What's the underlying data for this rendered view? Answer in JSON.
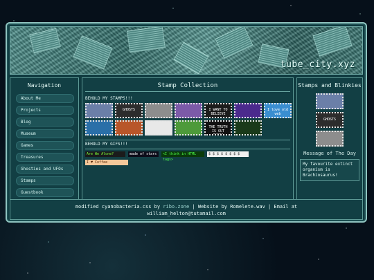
{
  "site": {
    "title": "tube_city.xyz"
  },
  "nav": {
    "title": "Navigation",
    "items": [
      {
        "label": "About Me"
      },
      {
        "label": "Projects"
      },
      {
        "label": "Blog"
      },
      {
        "label": "Museum"
      },
      {
        "label": "Games"
      },
      {
        "label": "Treasures"
      },
      {
        "label": "Ghosties and UFOs"
      },
      {
        "label": "Stamps"
      },
      {
        "label": "Guestbook"
      }
    ]
  },
  "main": {
    "title": "Stamp Collection",
    "stamps_heading": "BEHOLD MY STAMPS!!!",
    "stamps": [
      {
        "caption": "",
        "color": "#6b7fa8",
        "icon": "computer-icon"
      },
      {
        "caption": "GHOSTS",
        "color": "#2c2c2c",
        "icon": "ghost-icon"
      },
      {
        "caption": "",
        "color": "#8d8d8d",
        "icon": "ufo-icon"
      },
      {
        "caption": "",
        "color": "#7c5aa8",
        "icon": "spiral-icon"
      },
      {
        "caption": "I WANT TO BELIEVE",
        "color": "#1b1b1b",
        "icon": "ufo-icon"
      },
      {
        "caption": "",
        "color": "#4b2a8d",
        "icon": "retro-web-icon"
      },
      {
        "caption": "I love old web",
        "color": "#3a8ed0",
        "icon": "heart-icon"
      },
      {
        "caption": "",
        "color": "#2a6fa8",
        "icon": "water-icon"
      },
      {
        "caption": "",
        "color": "#b8562a",
        "icon": "animal-icon"
      },
      {
        "caption": "",
        "color": "#e8e8e8",
        "icon": "neocities-icon"
      },
      {
        "caption": "",
        "color": "#4d9a3a",
        "icon": "minecraft-icon"
      },
      {
        "caption": "THE TRUTH IS OUT THERE",
        "color": "#111111",
        "icon": "truth-icon"
      },
      {
        "caption": "",
        "color": "#1a3a1a",
        "icon": "alien-icon"
      }
    ],
    "gifs_heading": "BEHOLD MY GIFS!!!",
    "gifs": [
      {
        "text": "Are We Alone?",
        "bg": "#1b1b1b",
        "fg": "#7cff3a",
        "icon": "alien-gif-icon"
      },
      {
        "text": "made of stars",
        "bg": "#0d0d1a",
        "fg": "#ffffff",
        "icon": "stars-gif-icon"
      },
      {
        "text": "<I think in HTML tags>",
        "bg": "#0a3a0a",
        "fg": "#4dff4d",
        "icon": "html-gif-icon"
      },
      {
        "text": "$ $ $ $ $ $ $ $",
        "bg": "#f0f0f0",
        "fg": "#222222",
        "icon": "money-gif-icon"
      },
      {
        "text": "I ♥ Coffee",
        "bg": "#f4c89a",
        "fg": "#5a2a0a",
        "icon": "coffee-gif-icon"
      }
    ]
  },
  "side": {
    "title": "Stamps and Blinkies",
    "stamps": [
      {
        "caption": "",
        "color": "#6b7fa8"
      },
      {
        "caption": "GHOSTS",
        "color": "#2c2c2c"
      },
      {
        "caption": "",
        "color": "#8d8d8d"
      }
    ],
    "motd_title": "Message of The Day",
    "motd_text": "My favourite extinct organism is Brachiosaurus!"
  },
  "footer": {
    "part1": "modified cyanobacteria.css by ",
    "link1": "ribo.zone",
    "part2": " | Website by Romelete.wav | Email at",
    "line2": "william_helton@tutamail.com"
  }
}
